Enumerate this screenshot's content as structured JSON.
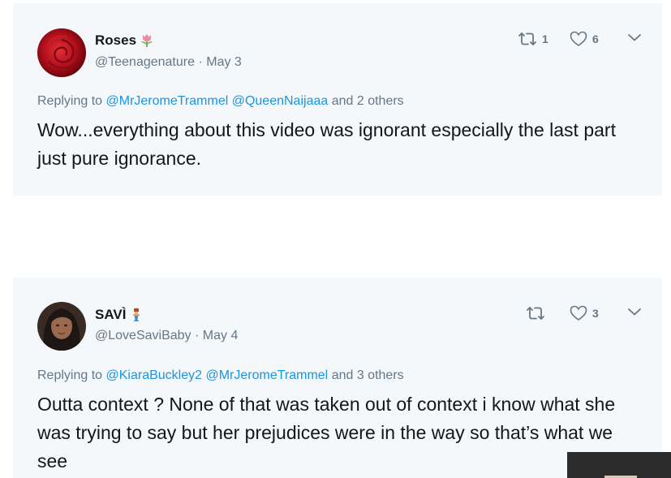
{
  "tweets": [
    {
      "display_name": "Roses",
      "name_emoji": "tulip-emoji",
      "handle": "@Teenagenature",
      "separator": "·",
      "date": "May 3",
      "retweet_count": "1",
      "like_count": "6",
      "replying_prefix": "Replying to",
      "mention_1": "@MrJeromeTrammel",
      "mention_2": "@QueenNaijaaa",
      "replying_suffix": "and 2 others",
      "text": "Wow...everything about this video was ignorant especially the last part just pure ignorance."
    },
    {
      "display_name": "SAVÌ",
      "name_emoji": "mermaid-emoji",
      "handle": "@LoveSaviBaby",
      "separator": "·",
      "date": "May 4",
      "retweet_count": "",
      "like_count": "3",
      "replying_prefix": "Replying to",
      "mention_1": "@KiaraBuckley2",
      "mention_2": "@MrJeromeTrammel",
      "replying_suffix": "and 3 others",
      "text": "Outta context ? None of that was taken out of context i know what she was trying to say but her prejudices were in the way so that’s what we see"
    }
  ],
  "colors": {
    "card_background": "#f5f8fa",
    "text_primary": "#14171a",
    "text_secondary": "#657786",
    "link": "#1b95e0"
  },
  "icons": {
    "retweet": "retweet-icon",
    "like": "heart-icon",
    "more": "chevron-down-icon"
  }
}
